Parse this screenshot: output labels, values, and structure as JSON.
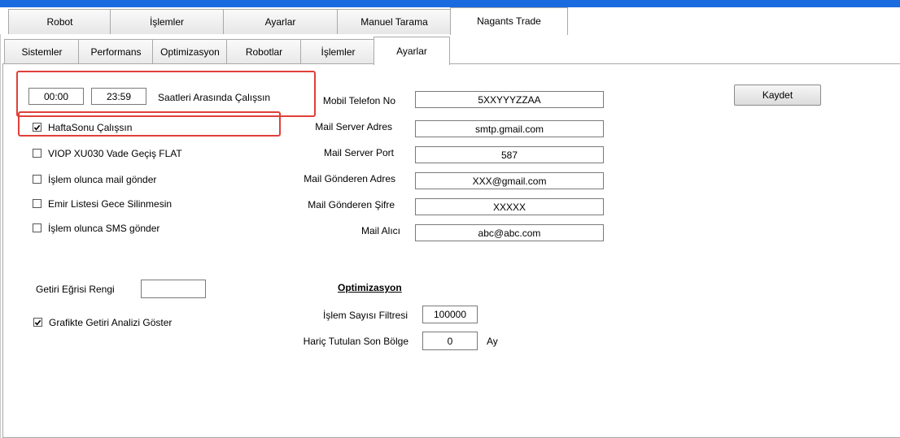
{
  "outer_tabs": [
    "Robot",
    "İşlemler",
    "Ayarlar",
    "Manuel Tarama",
    "Nagants Trade"
  ],
  "inner_tabs": [
    "Sistemler",
    "Performans",
    "Optimizasyon",
    "Robotlar",
    "İşlemler",
    "Ayarlar"
  ],
  "schedule": {
    "start_time": "00:00",
    "end_time": "23:59",
    "label": "Saatleri Arasında Çalışsın"
  },
  "checkboxes": {
    "weekend": {
      "label": "HaftaSonu Çalışsın",
      "checked": true
    },
    "viop": {
      "label": "VIOP XU030 Vade Geçiş FLAT",
      "checked": false
    },
    "mail_on_trade": {
      "label": "İşlem olunca mail gönder",
      "checked": false
    },
    "keep_orders": {
      "label": "Emir Listesi Gece Silinmesin",
      "checked": false
    },
    "sms_on_trade": {
      "label": "İşlem olunca SMS gönder",
      "checked": false
    },
    "show_return_analysis": {
      "label": "Grafikte Getiri Analizi Göster",
      "checked": true
    }
  },
  "contact": {
    "mobile_label": "Mobil Telefon No",
    "mobile_value": "5XXYYYZZAA",
    "server_label": "Mail Server Adres",
    "server_value": "smtp.gmail.com",
    "port_label": "Mail Server Port",
    "port_value": "587",
    "sender_label": "Mail Gönderen Adres",
    "sender_value": "XXX@gmail.com",
    "password_label": "Mail Gönderen Şifre",
    "password_value": "XXXXX",
    "recipient_label": "Mail Alıcı",
    "recipient_value": "abc@abc.com"
  },
  "save_label": "Kaydet",
  "return_curve": {
    "label": "Getiri Eğrisi Rengi",
    "value": ""
  },
  "optimization": {
    "title": "Optimizasyon",
    "filter_label": "İşlem Sayısı Filtresi",
    "filter_value": "100000",
    "exclude_label": "Hariç Tutulan Son Bölge",
    "exclude_value": "0",
    "exclude_unit": "Ay"
  }
}
